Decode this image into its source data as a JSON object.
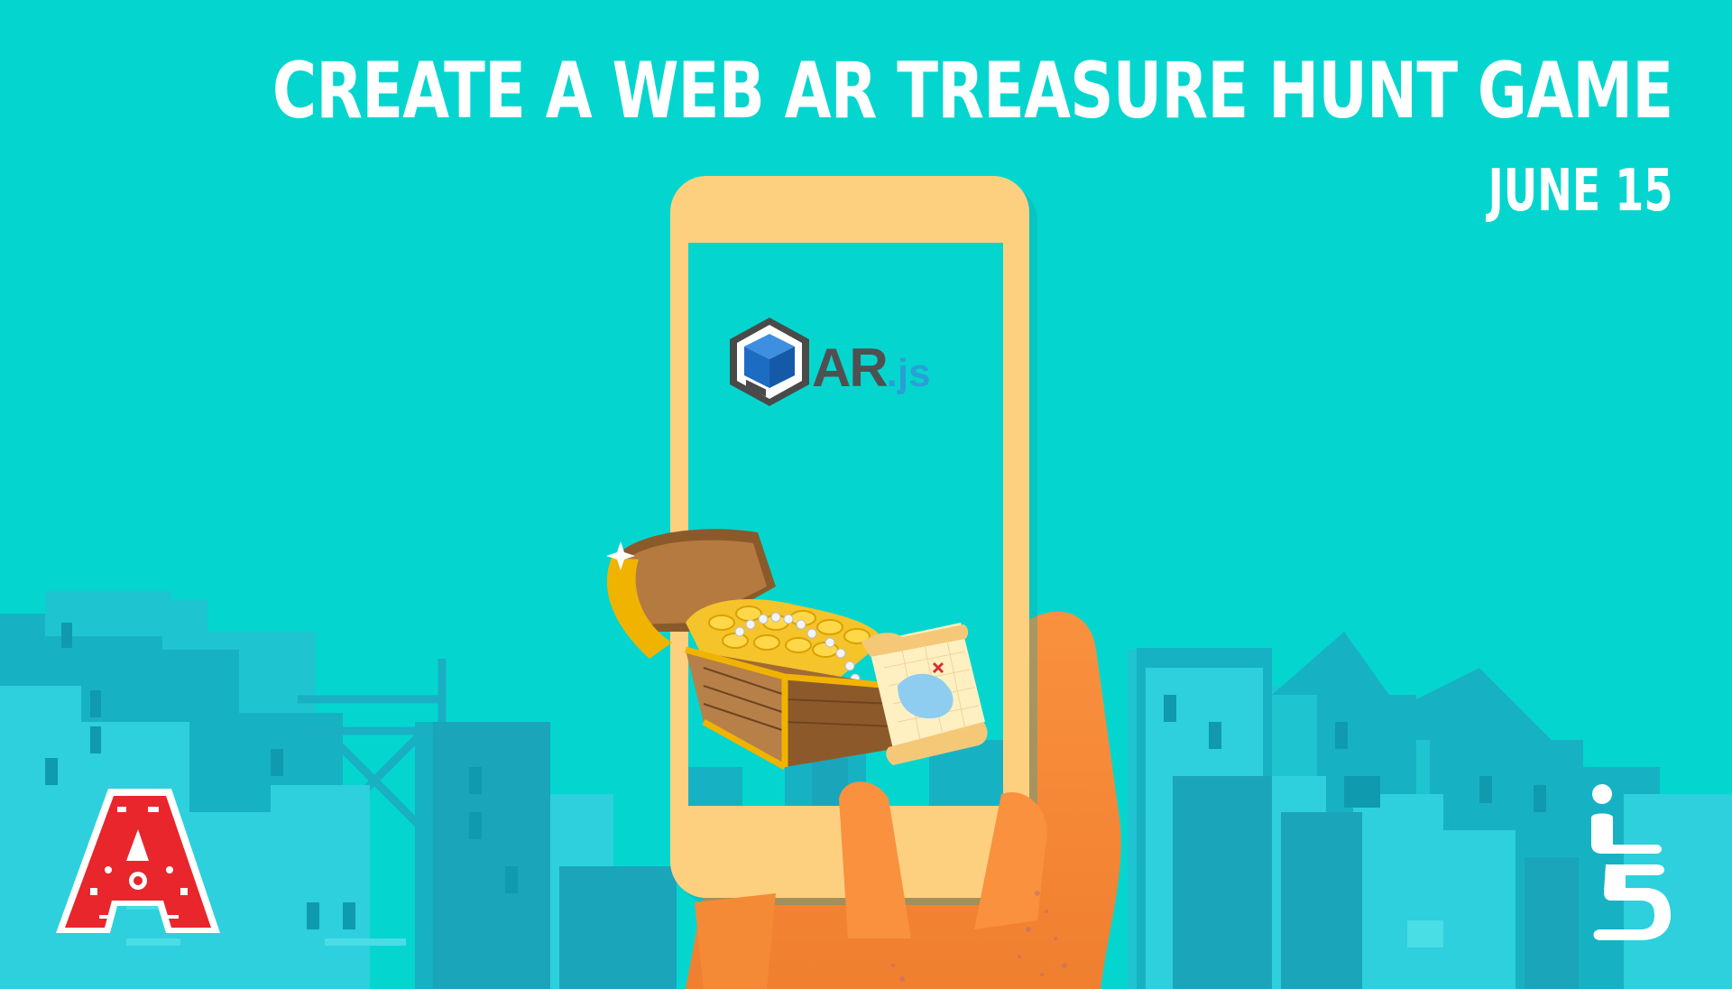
{
  "poster": {
    "title": "CREATE A WEB AR TREASURE HUNT GAME",
    "date": "JUNE 15"
  },
  "phone_screen": {
    "logo_name": "AR",
    "logo_ext": ".js"
  },
  "colors": {
    "background": "#04d6cf",
    "phone_body": "#fdd080",
    "hand": "#f9913f",
    "buildings_dark": "#13a9bd",
    "buildings_light": "#2ed0db",
    "logo_left_red": "#e8262c",
    "text": "#ffffff"
  },
  "icons": {
    "left_logo": "maker-a-logo",
    "right_logo": "i5-logo",
    "phone_logo": "arjs-cube-logo"
  }
}
